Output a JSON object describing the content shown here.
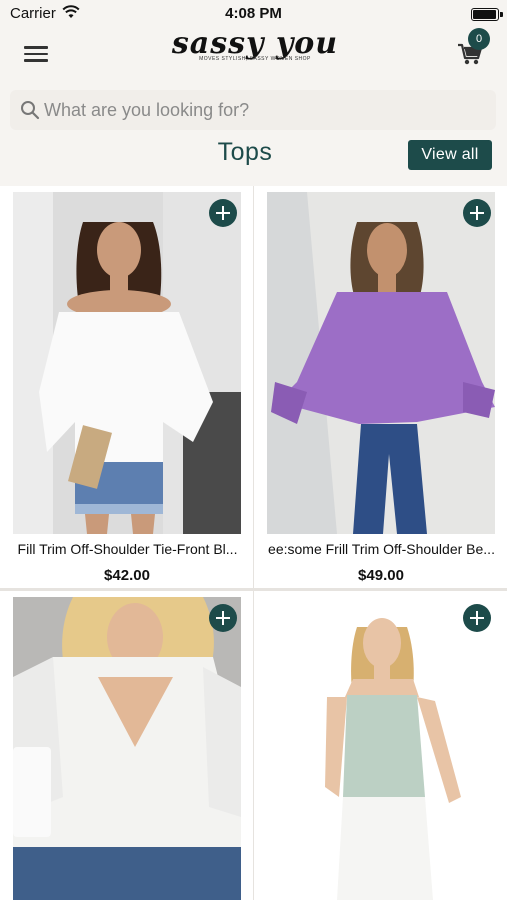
{
  "status_bar": {
    "carrier": "Carrier",
    "time": "4:08 PM"
  },
  "header": {
    "logo_text": "sassy you",
    "logo_tagline": "MOVES STYLISH, SASSY WOMEN SHOP",
    "cart_count": "0"
  },
  "search": {
    "placeholder": "What are you looking for?"
  },
  "section": {
    "title": "Tops",
    "view_all_label": "View all"
  },
  "colors": {
    "accent": "#1d4b4a",
    "background": "#f6f4f1"
  },
  "products": [
    {
      "name": "Fill Trim Off-Shoulder Tie-Front Bl...",
      "price": "$42.00",
      "add_icon": "plus-icon"
    },
    {
      "name": "ee:some Frill Trim Off-Shoulder Be...",
      "price": "$49.00",
      "add_icon": "plus-icon"
    },
    {
      "name": "",
      "price": "",
      "add_icon": "plus-icon"
    },
    {
      "name": "",
      "price": "",
      "add_icon": "plus-icon"
    }
  ]
}
